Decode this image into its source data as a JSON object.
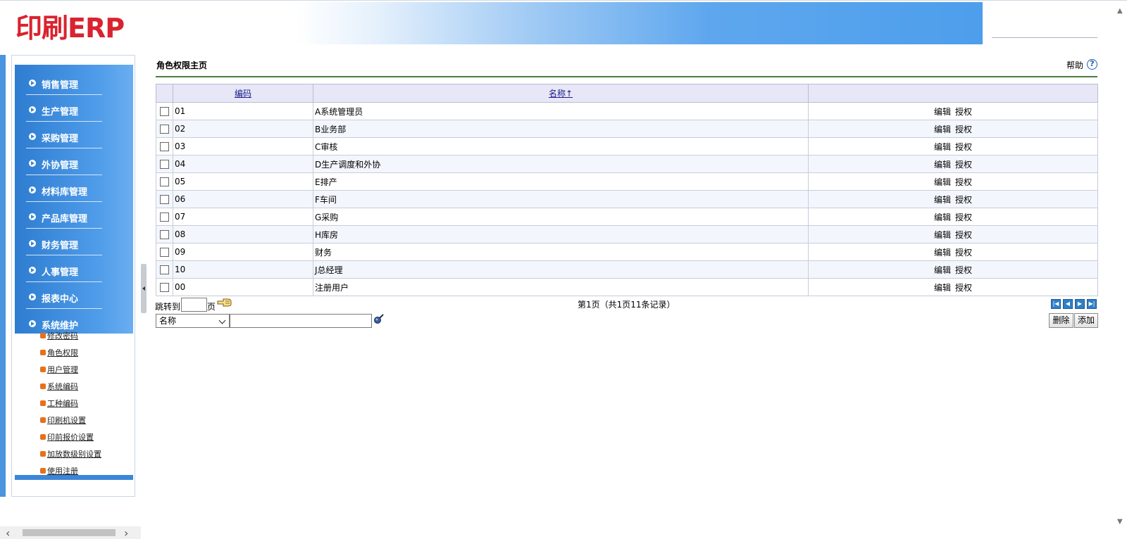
{
  "header": {
    "logo": "印刷ERP"
  },
  "sidebar": {
    "menu": [
      {
        "label": "销售管理"
      },
      {
        "label": "生产管理"
      },
      {
        "label": "采购管理"
      },
      {
        "label": "外协管理"
      },
      {
        "label": "材料库管理"
      },
      {
        "label": "产品库管理"
      },
      {
        "label": "财务管理"
      },
      {
        "label": "人事管理"
      },
      {
        "label": "报表中心"
      },
      {
        "label": "系统维护"
      }
    ],
    "submenu": [
      {
        "label": "修改密码"
      },
      {
        "label": "角色权限"
      },
      {
        "label": "用户管理"
      },
      {
        "label": "系统编码"
      },
      {
        "label": "工种编码"
      },
      {
        "label": "印刷机设置"
      },
      {
        "label": "印前报价设置"
      },
      {
        "label": "加放数级别设置"
      },
      {
        "label": "使用注册"
      }
    ]
  },
  "main": {
    "title": "角色权限主页",
    "help": "帮助",
    "help_icon": "?",
    "table": {
      "headers": {
        "code": "编码",
        "name": "名称↑",
        "actions": ""
      },
      "edit_label": "编辑",
      "grant_label": "授权",
      "rows": [
        {
          "code": "01",
          "name": "A系统管理员"
        },
        {
          "code": "02",
          "name": "B业务部"
        },
        {
          "code": "03",
          "name": "C审核"
        },
        {
          "code": "04",
          "name": "D生产调度和外协"
        },
        {
          "code": "05",
          "name": "E排产"
        },
        {
          "code": "06",
          "name": "F车间"
        },
        {
          "code": "07",
          "name": "G采购"
        },
        {
          "code": "08",
          "name": "H库房"
        },
        {
          "code": "09",
          "name": "财务"
        },
        {
          "code": "10",
          "name": "J总经理"
        },
        {
          "code": "00",
          "name": "注册用户"
        }
      ]
    },
    "pager": {
      "jump_label": "跳转到",
      "page_suffix": "页",
      "jump_value": "",
      "info": "第1页（共1页11条记录）",
      "icons": [
        "first-page-icon",
        "prev-page-icon",
        "next-page-icon",
        "last-page-icon"
      ]
    },
    "search": {
      "field_selected": "名称",
      "value": ""
    },
    "buttons": {
      "delete": "删除",
      "add": "添加"
    }
  },
  "colors": {
    "logo_red": "#d9232e",
    "menu_blue": "#4f9cea",
    "title_rule_green": "#4e7c3f",
    "header_row": "#e7e7f7"
  }
}
